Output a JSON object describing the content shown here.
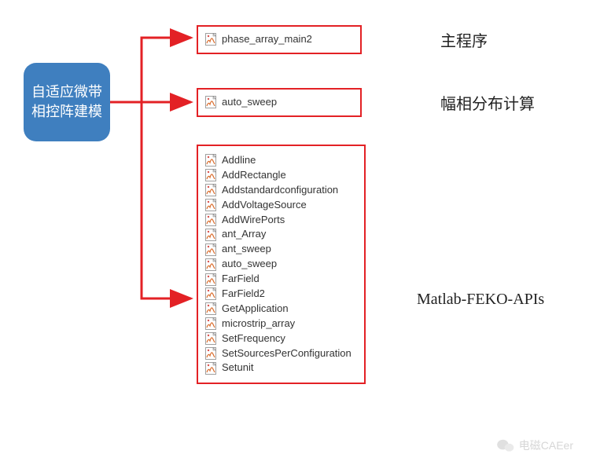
{
  "root": {
    "title": "自适应微带相控阵建模"
  },
  "boxes": {
    "box1": {
      "items": [
        "phase_array_main2"
      ]
    },
    "box2": {
      "items": [
        "auto_sweep"
      ]
    },
    "box3": {
      "items": [
        "Addline",
        "AddRectangle",
        "Addstandardconfiguration",
        "AddVoltageSource",
        "AddWirePorts",
        "ant_Array",
        "ant_sweep",
        "auto_sweep",
        "FarField",
        "FarField2",
        "GetApplication",
        "microstrip_array",
        "SetFrequency",
        "SetSourcesPerConfiguration",
        "Setunit"
      ]
    }
  },
  "labels": {
    "l1": "主程序",
    "l2": "幅相分布计算",
    "l3": "Matlab-FEKO-APIs"
  },
  "watermark": "电磁CAEer",
  "colors": {
    "arrow": "#e32125",
    "node": "#3f7fbf"
  }
}
